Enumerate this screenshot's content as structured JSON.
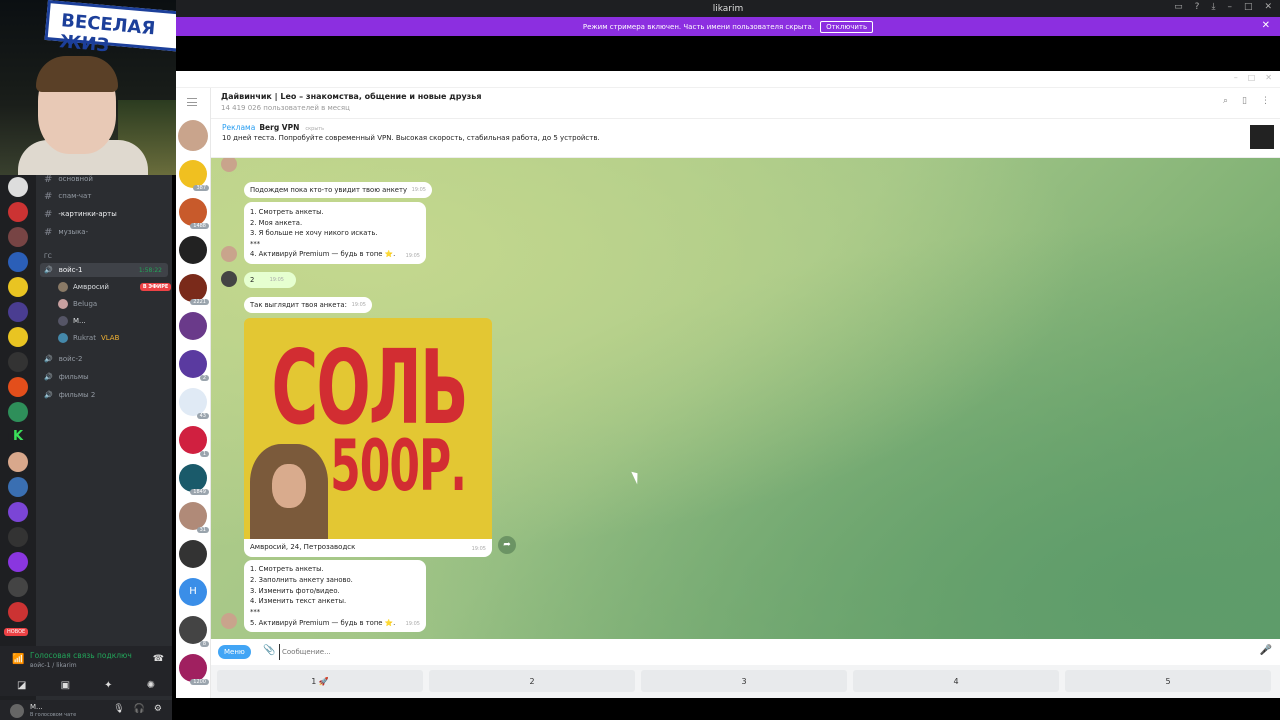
{
  "discord": {
    "window_title": "likarim",
    "streamer_banner": "Режим стримера включен. Часть имени пользователя скрыта.",
    "streamer_button": "Отключить",
    "channels": [
      {
        "name": "основной"
      },
      {
        "name": "спам-чат"
      },
      {
        "name": "-картинки-арты"
      },
      {
        "name": "музыка-"
      }
    ],
    "category": "ГС",
    "voice_channel": {
      "name": "войс-1",
      "timer": "1:58:22"
    },
    "voice_users": [
      {
        "name": "Амвросий",
        "badge": "В ЭФИРЕ"
      },
      {
        "name": "Beluga"
      },
      {
        "name": "М..."
      },
      {
        "name": "Rukrat",
        "tag": "VLAB"
      }
    ],
    "other_voice": [
      {
        "name": "войс-2"
      },
      {
        "name": "фильмы"
      },
      {
        "name": "фильмы 2"
      }
    ],
    "new_badge": "НОВОЕ",
    "voice_status": {
      "title": "Голосовая связь подключ",
      "sub": "войс-1 / likarim"
    },
    "user": {
      "name": "М...",
      "status": "В голосовом чате"
    }
  },
  "webcam": {
    "sign_text": "ВЕСЕЛАЯ ЖИЗ"
  },
  "telegram": {
    "header": {
      "title": "Дайвинчик | Leo – знакомства, общение и новые друзья",
      "subtitle": "14 419 026 пользователей в месяц"
    },
    "pinned": {
      "label": "Реклама",
      "name": "Berg VPN",
      "hide": "скрыть",
      "text": "10 дней теста. Попробуйте современный VPN. Высокая скорость, стабильная работа, до 5 устройств."
    },
    "chat_badges": [
      "387",
      "1488",
      "",
      "2221",
      "",
      "2",
      "43",
      "1",
      "1849",
      "31",
      "",
      "",
      "8",
      "1200"
    ],
    "messages": {
      "m1": {
        "text": "Подождем пока кто-то увидит твою анкету",
        "time": "19:05"
      },
      "m2": {
        "l1": "1. Смотреть анкеты.",
        "l2": "2. Моя анкета.",
        "l3": "3. Я больше не хочу никого искать.",
        "l4": "***",
        "l5": "4. Активируй Premium — будь в топе ⭐.",
        "time": "19:05"
      },
      "m3": {
        "text": "2",
        "time": "19:05"
      },
      "m4": {
        "text": "Так выглядит твоя анкета:",
        "time": "19:05"
      },
      "poster": {
        "line1": "СОЛЬ",
        "line2": "500Р.",
        "caption": "Амвросий, 24, Петрозаводск",
        "time": "19:05"
      },
      "m5": {
        "l1": "1. Смотреть анкеты.",
        "l2": "2. Заполнить анкету заново.",
        "l3": "3. Изменить фото/видео.",
        "l4": "4. Изменить текст анкеты.",
        "l5": "***",
        "l6": "5. Активируй Premium — будь в топе ⭐.",
        "time": "19:05"
      }
    },
    "input": {
      "menu": "Меню",
      "placeholder": "Сообщение..."
    },
    "keyboard": [
      "1 🚀",
      "2",
      "3",
      "4",
      "5"
    ]
  }
}
